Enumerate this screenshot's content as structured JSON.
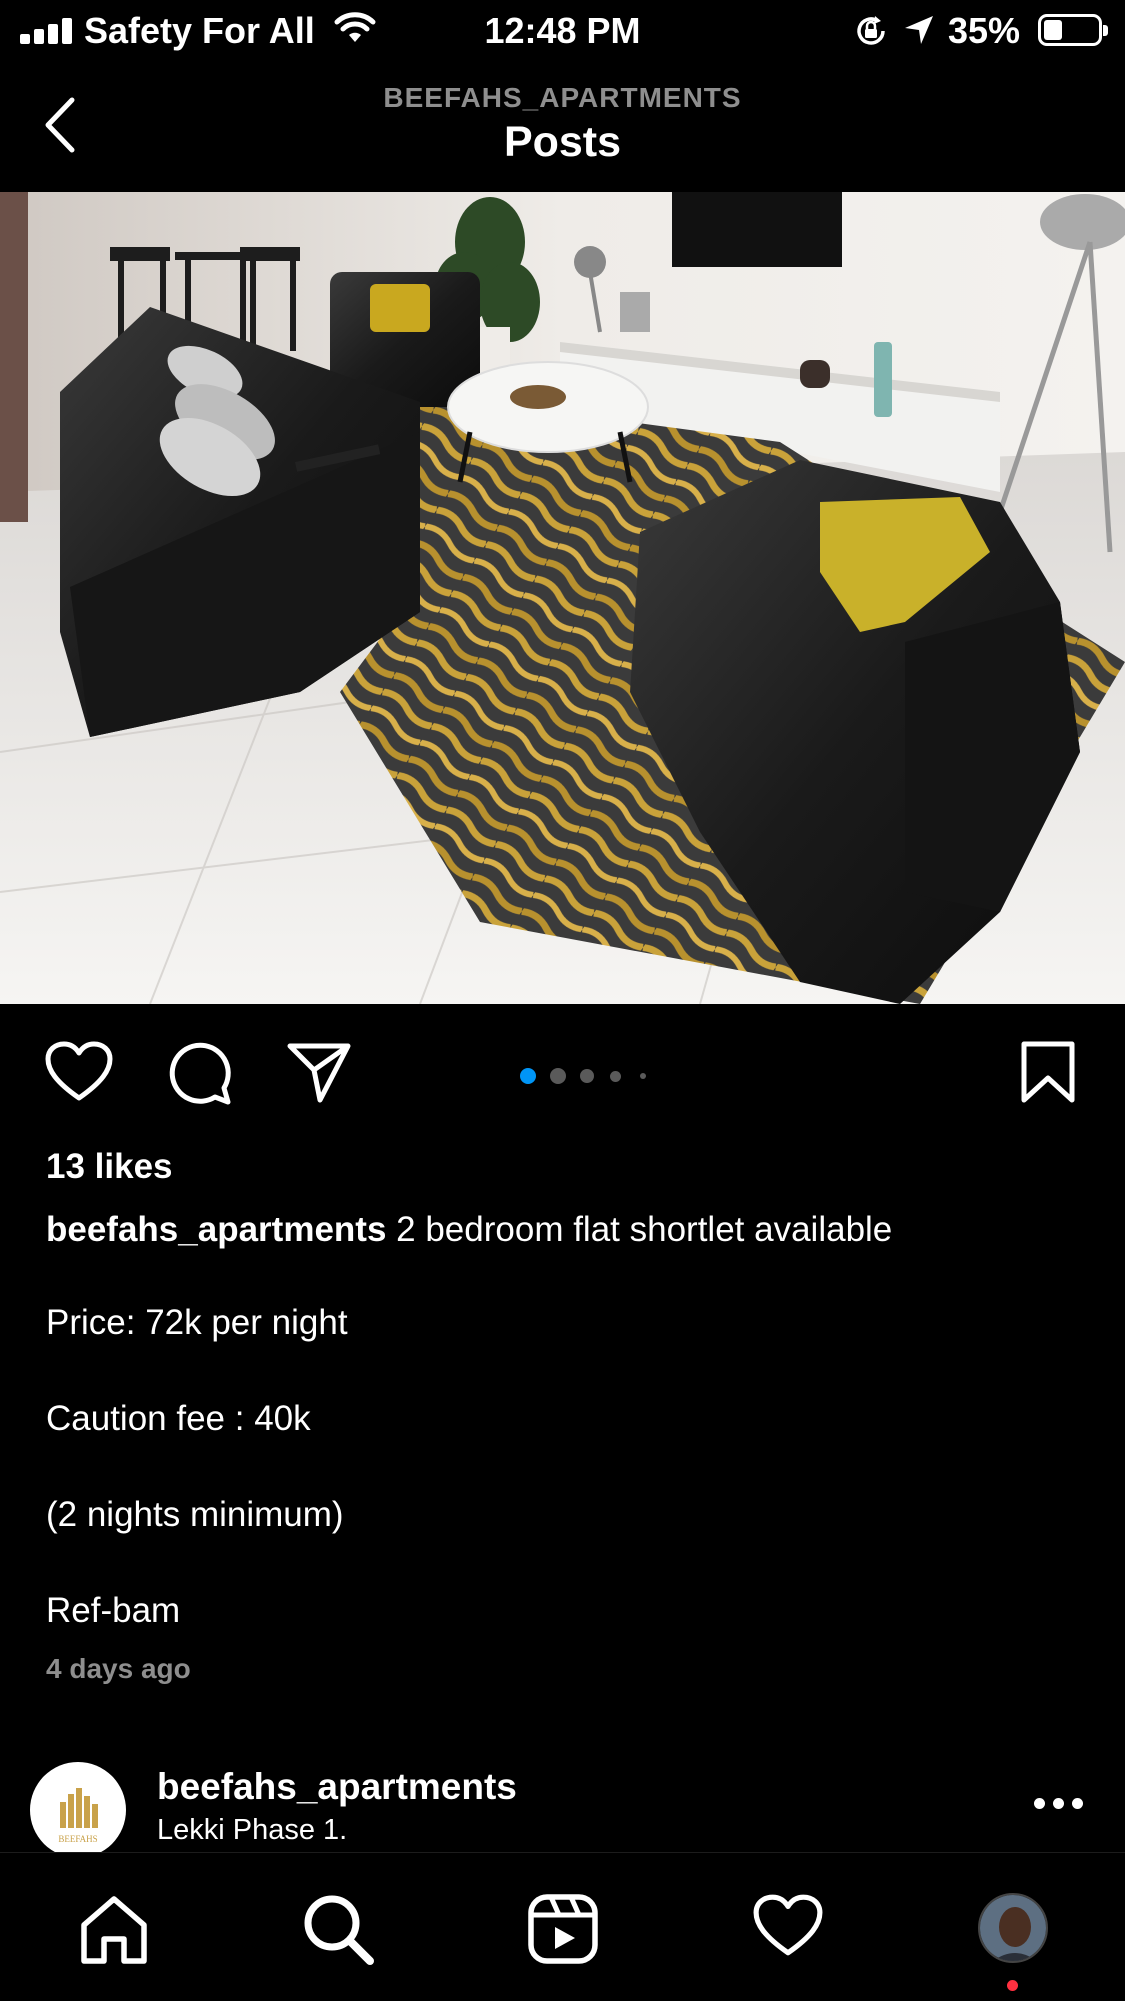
{
  "status_bar": {
    "carrier": "Safety For All",
    "time": "12:48 PM",
    "battery_percent": "35%",
    "battery_level": 0.35,
    "icons": [
      "signal-icon",
      "wifi-icon",
      "rotation-lock-icon",
      "location-arrow-icon",
      "battery-icon"
    ]
  },
  "header": {
    "username": "BEEFAHS_APARTMENTS",
    "title": "Posts",
    "back_icon": "chevron-left-icon"
  },
  "post": {
    "image_description_alt": "Living room with black leather sofas, gold cushions, round marble coffee table and gold-striped rug",
    "actions": {
      "like_icon": "heart-icon",
      "comment_icon": "comment-icon",
      "share_icon": "send-icon",
      "save_icon": "bookmark-icon"
    },
    "carousel": {
      "count": 5,
      "active_index": 0,
      "active_color": "#0095f6"
    },
    "likes": "13 likes",
    "caption_user": "beefahs_apartments",
    "caption_text": "2 bedroom flat shortlet available",
    "caption_lines": [
      "Price: 72k per night",
      "Caution fee : 40k",
      "(2 nights minimum)",
      "Ref-bam"
    ],
    "timestamp": "4 days ago"
  },
  "next_post": {
    "username": "beefahs_apartments",
    "location": "Lekki Phase 1.",
    "avatar_text": "BEEFAHS"
  },
  "tab_bar": {
    "tabs": [
      "home-icon",
      "search-icon",
      "reels-icon",
      "activity-heart-icon",
      "profile-avatar"
    ],
    "notification_color": "#ff3040"
  }
}
